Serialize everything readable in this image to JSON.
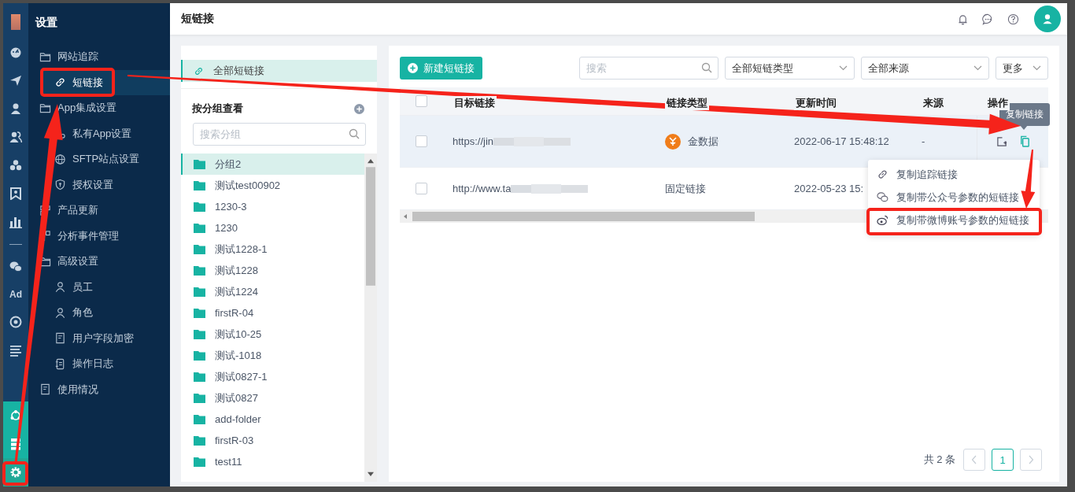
{
  "rail": {
    "top": [
      {
        "kind": "logo"
      },
      {
        "kind": "gauge"
      },
      {
        "kind": "send"
      },
      {
        "kind": "user"
      },
      {
        "kind": "users"
      },
      {
        "kind": "cluster"
      },
      {
        "kind": "bookmark"
      },
      {
        "kind": "bars"
      },
      {
        "kind": "divider"
      },
      {
        "kind": "chat"
      },
      {
        "kind": "text",
        "label": "Ad"
      },
      {
        "kind": "disc"
      },
      {
        "kind": "lines"
      }
    ],
    "bottom": [
      {
        "kind": "hub",
        "selected": false
      },
      {
        "kind": "server",
        "selected": false
      },
      {
        "kind": "gear",
        "selected": true
      }
    ]
  },
  "menu": {
    "title": "设置",
    "items": [
      {
        "label": "网站追踪",
        "kind": "folder",
        "selected": false,
        "children": [
          {
            "label": "短链接",
            "kind": "link",
            "selected": true
          }
        ]
      },
      {
        "label": "App集成设置",
        "kind": "folder",
        "selected": false,
        "children": [
          {
            "label": "私有App设置",
            "kind": "app",
            "selected": false
          },
          {
            "label": "SFTP站点设置",
            "kind": "globe",
            "selected": false
          },
          {
            "label": "授权设置",
            "kind": "shield",
            "selected": false
          }
        ]
      },
      {
        "label": "产品更新",
        "kind": "grid",
        "selected": false
      },
      {
        "label": "分析事件管理",
        "kind": "grid",
        "selected": false
      },
      {
        "label": "高级设置",
        "kind": "folder",
        "selected": false,
        "children": [
          {
            "label": "员工",
            "kind": "person",
            "selected": false
          },
          {
            "label": "角色",
            "kind": "person",
            "selected": false
          },
          {
            "label": "用户字段加密",
            "kind": "doc",
            "selected": false
          },
          {
            "label": "操作日志",
            "kind": "log",
            "selected": false
          }
        ]
      },
      {
        "label": "使用情况",
        "kind": "doc",
        "selected": false
      }
    ]
  },
  "topbar": {
    "title": "短链接"
  },
  "groups_panel": {
    "all": {
      "label": "全部短链接",
      "selected": true
    },
    "heading": "按分组查看",
    "search": {
      "placeholder": "搜索分组"
    },
    "groups": [
      {
        "label": "分组2",
        "selected": true
      },
      {
        "label": "测试test00902",
        "selected": false
      },
      {
        "label": "1230-3",
        "selected": false
      },
      {
        "label": "1230",
        "selected": false
      },
      {
        "label": "测试1228-1",
        "selected": false
      },
      {
        "label": "测试1228",
        "selected": false
      },
      {
        "label": "测试1224",
        "selected": false
      },
      {
        "label": "firstR-04",
        "selected": false
      },
      {
        "label": "测试10-25",
        "selected": false
      },
      {
        "label": "测试-1018",
        "selected": false
      },
      {
        "label": "测试0827-1",
        "selected": false
      },
      {
        "label": "测试0827",
        "selected": false
      },
      {
        "label": "add-folder",
        "selected": false
      },
      {
        "label": "firstR-03",
        "selected": false
      },
      {
        "label": "test11",
        "selected": false
      }
    ]
  },
  "toolbar": {
    "new_button": "新建短链接",
    "search": {
      "placeholder": "搜索"
    },
    "type_select": "全部短链类型",
    "source_select": "全部来源",
    "more_button": "更多"
  },
  "table": {
    "all_checked": false,
    "columns": [
      "目标链接",
      "链接类型",
      "更新时间",
      "来源",
      "操作"
    ],
    "rows": [
      {
        "checked": false,
        "hovered": true,
        "target": "https://jin",
        "type": "金数据",
        "kind": "logo",
        "time": "2022-06-17 15:48:12",
        "source": "-",
        "actions": true
      },
      {
        "checked": false,
        "hovered": false,
        "target": "http://www.ta",
        "type": "固定链接",
        "kind": "plain",
        "time": "2022-05-23 15:"
      }
    ]
  },
  "tooltip": "复制链接",
  "copy_menu": [
    {
      "label": "复制追踪链接",
      "kind": "link"
    },
    {
      "label": "复制带公众号参数的短链接",
      "kind": "wechat"
    },
    {
      "label": "复制带微博账号参数的短链接",
      "kind": "weibo"
    }
  ],
  "pagination": {
    "total": "共 2 条",
    "pages": [
      {
        "label": "1",
        "selected": true
      }
    ]
  }
}
